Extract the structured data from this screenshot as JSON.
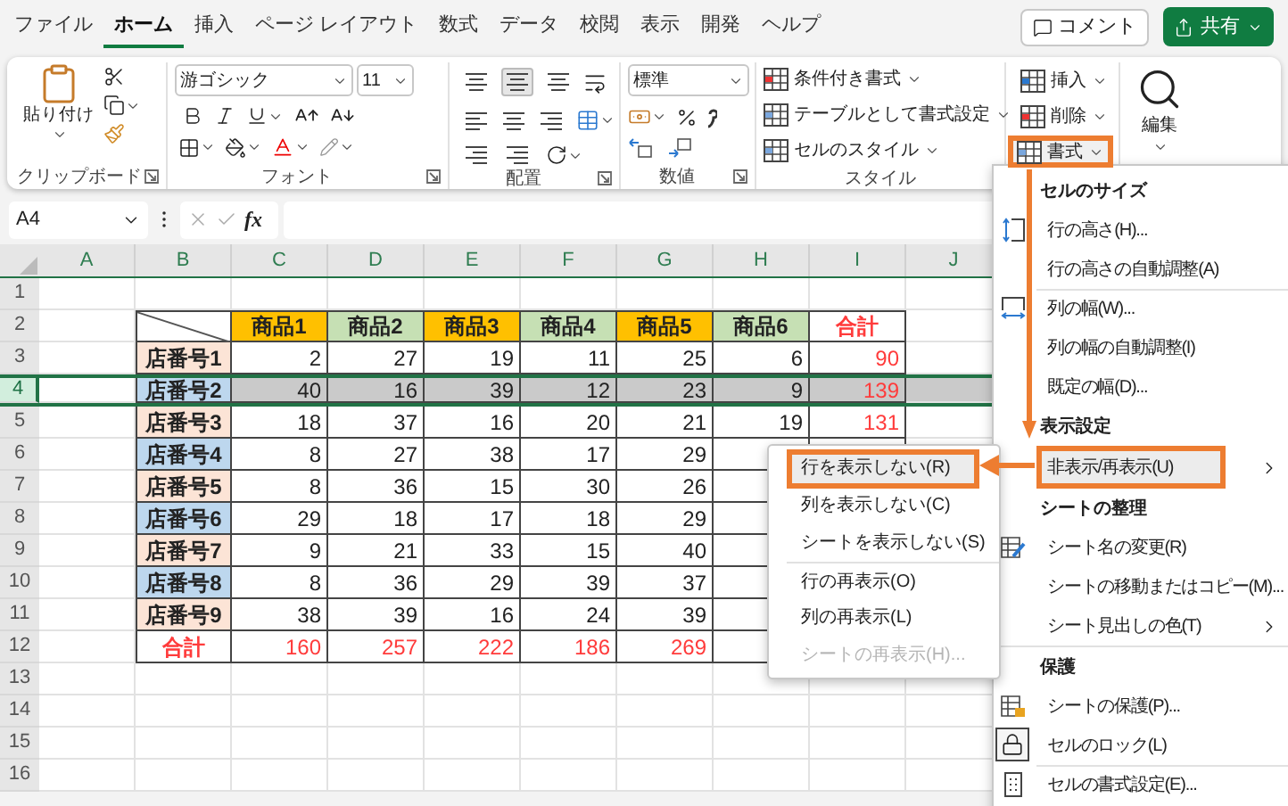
{
  "ribbon_tabs": [
    {
      "label": "ファイル",
      "selected": false
    },
    {
      "label": "ホーム",
      "selected": true
    },
    {
      "label": "挿入",
      "selected": false
    },
    {
      "label": "ページ レイアウト",
      "selected": false
    },
    {
      "label": "数式",
      "selected": false
    },
    {
      "label": "データ",
      "selected": false
    },
    {
      "label": "校閲",
      "selected": false
    },
    {
      "label": "表示",
      "selected": false
    },
    {
      "label": "開発",
      "selected": false
    },
    {
      "label": "ヘルプ",
      "selected": false
    }
  ],
  "comment_button": "コメント",
  "share_button": "共有",
  "ribbon": {
    "clipboard": {
      "paste": "貼り付け",
      "label": "クリップボード"
    },
    "font": {
      "name": "游ゴシック",
      "size": "11",
      "label": "フォント"
    },
    "alignment": {
      "label": "配置"
    },
    "number": {
      "format": "標準",
      "label": "数値"
    },
    "styles": {
      "buttons": [
        "条件付き書式",
        "テーブルとして書式設定",
        "セルのスタイル"
      ],
      "label": "スタイル"
    },
    "cells": [
      {
        "label": "挿入",
        "kind": "insert",
        "highlighted": false
      },
      {
        "label": "削除",
        "kind": "delete",
        "highlighted": false
      },
      {
        "label": "書式",
        "kind": "format",
        "highlighted": true
      }
    ],
    "editing": {
      "label": "編集"
    }
  },
  "formula_bar": {
    "name_box": "A4",
    "function_label": "fx"
  },
  "sheet": {
    "columns": [
      "A",
      "B",
      "C",
      "D",
      "E",
      "F",
      "G",
      "H",
      "I",
      "J"
    ],
    "rows": [
      {
        "label": "1",
        "selected": false
      },
      {
        "label": "2",
        "selected": false
      },
      {
        "label": "3",
        "selected": false
      },
      {
        "label": "4",
        "selected": true
      },
      {
        "label": "5",
        "selected": false
      },
      {
        "label": "6",
        "selected": false
      },
      {
        "label": "7",
        "selected": false
      },
      {
        "label": "8",
        "selected": false
      },
      {
        "label": "9",
        "selected": false
      },
      {
        "label": "10",
        "selected": false
      },
      {
        "label": "11",
        "selected": false
      },
      {
        "label": "12",
        "selected": false
      },
      {
        "label": "13",
        "selected": false
      },
      {
        "label": "14",
        "selected": false
      },
      {
        "label": "15",
        "selected": false
      },
      {
        "label": "16",
        "selected": false
      }
    ]
  },
  "table": {
    "columns": [
      {
        "label": "商品1",
        "kind": "product",
        "color": "#ffc000"
      },
      {
        "label": "商品2",
        "kind": "product",
        "color": "#c6e0b4"
      },
      {
        "label": "商品3",
        "kind": "product",
        "color": "#ffc000"
      },
      {
        "label": "商品4",
        "kind": "product",
        "color": "#c6e0b4"
      },
      {
        "label": "商品5",
        "kind": "product",
        "color": "#ffc000"
      },
      {
        "label": "商品6",
        "kind": "product",
        "color": "#c6e0b4"
      },
      {
        "label": "合計",
        "kind": "total"
      }
    ],
    "rows": [
      {
        "label": "店番号1",
        "kind": "store",
        "color": "#fce4d6",
        "values": [
          "2",
          "27",
          "19",
          "11",
          "25",
          "6",
          "90"
        ]
      },
      {
        "label": "店番号2",
        "kind": "store",
        "color": "#bdd7ee",
        "values": [
          "40",
          "16",
          "39",
          "12",
          "23",
          "9",
          "139"
        ]
      },
      {
        "label": "店番号3",
        "kind": "store",
        "color": "#fce4d6",
        "values": [
          "18",
          "37",
          "16",
          "20",
          "21",
          "19",
          "131"
        ]
      },
      {
        "label": "店番号4",
        "kind": "store",
        "color": "#bdd7ee",
        "values": [
          "8",
          "27",
          "38",
          "17",
          "29"
        ]
      },
      {
        "label": "店番号5",
        "kind": "store",
        "color": "#fce4d6",
        "values": [
          "8",
          "36",
          "15",
          "30",
          "26"
        ]
      },
      {
        "label": "店番号6",
        "kind": "store",
        "color": "#bdd7ee",
        "values": [
          "29",
          "18",
          "17",
          "18",
          "29"
        ]
      },
      {
        "label": "店番号7",
        "kind": "store",
        "color": "#fce4d6",
        "values": [
          "9",
          "21",
          "33",
          "15",
          "40"
        ]
      },
      {
        "label": "店番号8",
        "kind": "store",
        "color": "#bdd7ee",
        "values": [
          "8",
          "36",
          "29",
          "39",
          "37"
        ]
      },
      {
        "label": "店番号9",
        "kind": "store",
        "color": "#fce4d6",
        "values": [
          "38",
          "39",
          "16",
          "24",
          "39"
        ]
      },
      {
        "label": "合計",
        "kind": "total",
        "values": [
          "160",
          "257",
          "222",
          "186",
          "269"
        ]
      }
    ]
  },
  "format_menu": {
    "sections": [
      {
        "title": "セルのサイズ",
        "items": [
          {
            "label": "行の高さ(H)...",
            "divider_above": false,
            "has_submenu": false,
            "highlighted": false
          },
          {
            "label": "行の高さの自動調整(A)",
            "divider_above": false,
            "has_submenu": false,
            "highlighted": false
          },
          {
            "label": "列の幅(W)...",
            "divider_above": true,
            "has_submenu": false,
            "highlighted": false
          },
          {
            "label": "列の幅の自動調整(I)",
            "divider_above": false,
            "has_submenu": false,
            "highlighted": false
          },
          {
            "label": "既定の幅(D)...",
            "divider_above": false,
            "has_submenu": false,
            "highlighted": false
          }
        ]
      },
      {
        "title": "表示設定",
        "items": [
          {
            "label": "非表示/再表示(U)",
            "divider_above": false,
            "has_submenu": true,
            "highlighted": true
          }
        ]
      },
      {
        "title": "シートの整理",
        "items": [
          {
            "label": "シート名の変更(R)",
            "divider_above": false,
            "has_submenu": false,
            "highlighted": false
          },
          {
            "label": "シートの移動またはコピー(M)...",
            "divider_above": false,
            "has_submenu": false,
            "highlighted": false
          },
          {
            "label": "シート見出しの色(T)",
            "divider_above": false,
            "has_submenu": true,
            "highlighted": false
          }
        ]
      },
      {
        "title": "保護",
        "items": [
          {
            "label": "シートの保護(P)...",
            "divider_above": false,
            "has_submenu": false,
            "highlighted": false
          },
          {
            "label": "セルのロック(L)",
            "divider_above": false,
            "has_submenu": false,
            "highlighted": false
          },
          {
            "label": "セルの書式設定(E)...",
            "divider_above": true,
            "has_submenu": false,
            "highlighted": false
          }
        ]
      }
    ]
  },
  "submenu": {
    "items": [
      {
        "label": "行を表示しない(R)",
        "highlighted": true,
        "disabled": false,
        "divider_above": false
      },
      {
        "label": "列を表示しない(C)",
        "highlighted": false,
        "disabled": false,
        "divider_above": false
      },
      {
        "label": "シートを表示しない(S)",
        "highlighted": false,
        "disabled": false,
        "divider_above": false
      },
      {
        "label": "行の再表示(O)",
        "highlighted": false,
        "disabled": false,
        "divider_above": true
      },
      {
        "label": "列の再表示(L)",
        "highlighted": false,
        "disabled": false,
        "divider_above": false
      },
      {
        "label": "シートの再表示(H)...",
        "highlighted": false,
        "disabled": true,
        "divider_above": false
      }
    ]
  }
}
